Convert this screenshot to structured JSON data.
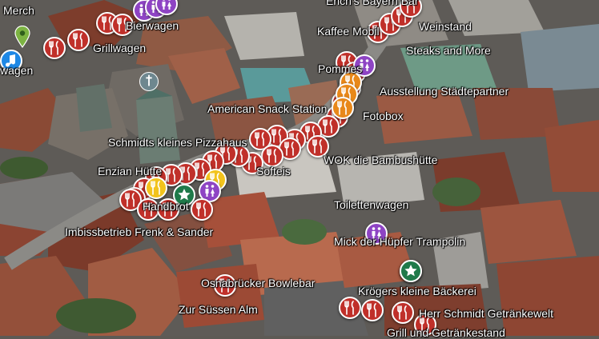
{
  "colors": {
    "food": "#c0302a",
    "restroom": "#8e44c4",
    "star": "#1f7a4a",
    "orange": "#e8881a",
    "yellow": "#f2c31c",
    "music": "#1e88e5",
    "place_pin": "#7cb342"
  },
  "map": {
    "labels": [
      {
        "text": "Merch"
      },
      {
        "text": "wagen"
      },
      {
        "text": "Grillwagen"
      },
      {
        "text": "Bierwagen"
      },
      {
        "text": "Erich's Bayern Bar"
      },
      {
        "text": "Kaffee Mobil"
      },
      {
        "text": "Weinstand"
      },
      {
        "text": "Steaks and More"
      },
      {
        "text": "Pommes"
      },
      {
        "text": "Ausstellung Städtepartner"
      },
      {
        "text": "American Snack Station"
      },
      {
        "text": "Fotobox"
      },
      {
        "text": "Schmidts kleines Pizzahaus"
      },
      {
        "text": "WOK die Bambushütte"
      },
      {
        "text": "Enzian Hütte"
      },
      {
        "text": "Softeis"
      },
      {
        "text": "Handbrot"
      },
      {
        "text": "Toilettenwagen"
      },
      {
        "text": "Imbissbetrieb Frenk & Sander"
      },
      {
        "text": "Mick der Hüpfer Trampolin"
      },
      {
        "text": "Osnabrücker Bowlebar"
      },
      {
        "text": "Krögers kleine Bäckerei"
      },
      {
        "text": "Zur Süssen Alm"
      },
      {
        "text": "Herr Schmidt Getränkewelt"
      },
      {
        "text": "Grill und Getränkestand"
      }
    ],
    "markers": [
      {
        "kind": "restaurant-icon",
        "color": "food"
      },
      {
        "kind": "restaurant-icon",
        "color": "food"
      },
      {
        "kind": "restaurant-icon",
        "color": "food"
      },
      {
        "kind": "restaurant-icon",
        "color": "food"
      },
      {
        "kind": "restroom-icon",
        "color": "restroom"
      },
      {
        "kind": "restroom-icon",
        "color": "restroom"
      },
      {
        "kind": "restroom-icon",
        "color": "restroom"
      },
      {
        "kind": "music-note-icon",
        "color": "music"
      },
      {
        "kind": "map-pin-icon",
        "color": "place_pin"
      },
      {
        "kind": "church-icon",
        "color": "white"
      },
      {
        "kind": "restaurant-icon",
        "color": "food"
      },
      {
        "kind": "restaurant-icon",
        "color": "food"
      },
      {
        "kind": "restaurant-icon",
        "color": "food"
      },
      {
        "kind": "restaurant-icon",
        "color": "food"
      },
      {
        "kind": "restaurant-icon",
        "color": "food"
      },
      {
        "kind": "restaurant-icon",
        "color": "food"
      },
      {
        "kind": "restaurant-icon",
        "color": "food"
      },
      {
        "kind": "restaurant-icon",
        "color": "food"
      },
      {
        "kind": "restaurant-icon",
        "color": "food"
      },
      {
        "kind": "restroom-icon",
        "color": "restroom"
      },
      {
        "kind": "restaurant-icon",
        "color": "orange"
      },
      {
        "kind": "restaurant-icon",
        "color": "orange"
      },
      {
        "kind": "restaurant-icon",
        "color": "orange"
      },
      {
        "kind": "restaurant-icon",
        "color": "food"
      },
      {
        "kind": "restaurant-icon",
        "color": "food"
      },
      {
        "kind": "restaurant-icon",
        "color": "food"
      },
      {
        "kind": "restaurant-icon",
        "color": "food"
      },
      {
        "kind": "restaurant-icon",
        "color": "food"
      },
      {
        "kind": "restaurant-icon",
        "color": "food"
      },
      {
        "kind": "restaurant-icon",
        "color": "food"
      },
      {
        "kind": "restaurant-icon",
        "color": "food"
      },
      {
        "kind": "restaurant-icon",
        "color": "food"
      },
      {
        "kind": "restaurant-icon",
        "color": "food"
      },
      {
        "kind": "restaurant-icon",
        "color": "food"
      },
      {
        "kind": "restaurant-icon",
        "color": "food"
      },
      {
        "kind": "restaurant-icon",
        "color": "food"
      },
      {
        "kind": "restaurant-icon",
        "color": "food"
      },
      {
        "kind": "restaurant-icon",
        "color": "food"
      },
      {
        "kind": "restaurant-icon",
        "color": "food"
      },
      {
        "kind": "restaurant-icon",
        "color": "food"
      },
      {
        "kind": "restaurant-icon",
        "color": "food"
      },
      {
        "kind": "restaurant-icon",
        "color": "yellow"
      },
      {
        "kind": "restaurant-icon",
        "color": "yellow"
      },
      {
        "kind": "star-icon",
        "color": "star"
      },
      {
        "kind": "star-icon",
        "color": "star"
      },
      {
        "kind": "restroom-icon",
        "color": "restroom"
      },
      {
        "kind": "restaurant-icon",
        "color": "food"
      },
      {
        "kind": "restaurant-icon",
        "color": "food"
      },
      {
        "kind": "restaurant-icon",
        "color": "food"
      },
      {
        "kind": "restaurant-icon",
        "color": "food"
      },
      {
        "kind": "restroom-icon",
        "color": "restroom"
      },
      {
        "kind": "star-icon",
        "color": "star"
      },
      {
        "kind": "restaurant-icon",
        "color": "food"
      },
      {
        "kind": "restaurant-icon",
        "color": "food"
      },
      {
        "kind": "restaurant-icon",
        "color": "food"
      },
      {
        "kind": "restaurant-icon",
        "color": "food"
      },
      {
        "kind": "restaurant-icon",
        "color": "food"
      }
    ]
  }
}
